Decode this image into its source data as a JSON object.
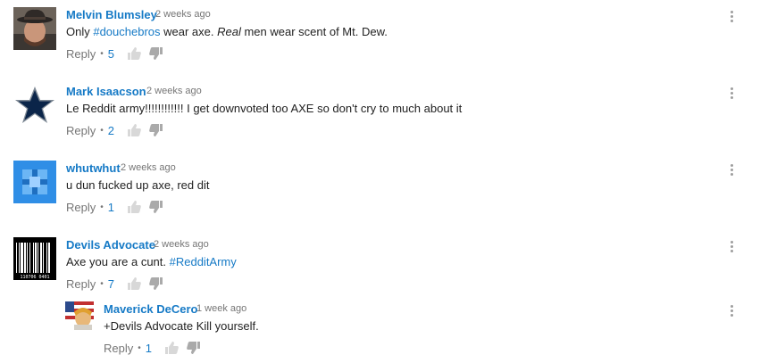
{
  "comments": [
    {
      "author": "Melvin Blumsley",
      "time": "2 weeks ago",
      "segments": [
        {
          "text": "Only "
        },
        {
          "text": "#douchebros",
          "tag": true
        },
        {
          "text": " wear axe. "
        },
        {
          "text": "Real",
          "italic": true
        },
        {
          "text": " men wear scent of Mt. Dew."
        }
      ],
      "reply_label": "Reply",
      "likes": "5",
      "avatar": "man-with-hat-photo"
    },
    {
      "author": "Mark Isaacson",
      "time": "2 weeks ago",
      "segments": [
        {
          "text": "Le Reddit army!!!!!!!!!!!! I get downvoted too AXE so don't cry to much about it"
        }
      ],
      "reply_label": "Reply",
      "likes": "2",
      "avatar": "star-logo"
    },
    {
      "author": "whutwhut",
      "time": "2 weeks ago",
      "segments": [
        {
          "text": "u dun fucked up axe, red dit"
        }
      ],
      "reply_label": "Reply",
      "likes": "1",
      "avatar": "blue-cross-icon"
    },
    {
      "author": "Devils Advocate",
      "time": "2 weeks ago",
      "segments": [
        {
          "text": "Axe you are a cunt.  "
        },
        {
          "text": "#RedditArmy",
          "tag": true
        }
      ],
      "reply_label": "Reply",
      "likes": "7",
      "avatar": "barcode-image"
    },
    {
      "author": "Maverick DeCero",
      "time": "1 week ago",
      "segments": [
        {
          "text": "+Devils Advocate Kill yourself."
        }
      ],
      "reply_label": "Reply",
      "likes": "1",
      "avatar": "cartoon-flag-image"
    }
  ],
  "barcode_digits": "110706 0401",
  "colors": {
    "author": "#167ac6",
    "text": "#222222",
    "meta": "#767676",
    "icon": "#9e9e9e"
  }
}
